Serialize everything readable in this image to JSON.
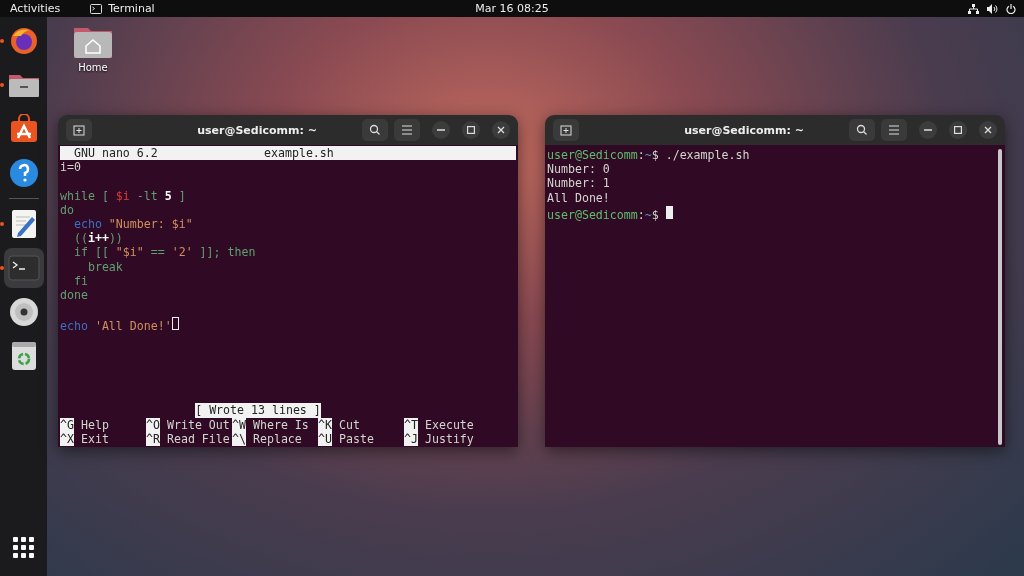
{
  "top_bar": {
    "activities": "Activities",
    "app_name": "Terminal",
    "clock": "Mar 16  08:25"
  },
  "dock": {
    "favorites": [
      {
        "kind": "browser",
        "running": true,
        "selected": false
      },
      {
        "kind": "files",
        "running": true,
        "selected": false
      },
      {
        "kind": "store",
        "running": false,
        "selected": false
      },
      {
        "kind": "help",
        "running": false,
        "selected": false
      }
    ],
    "others": [
      {
        "kind": "editor",
        "running": true,
        "selected": false
      },
      {
        "kind": "terminal",
        "running": true,
        "selected": true
      },
      {
        "kind": "disc",
        "running": false,
        "selected": false
      },
      {
        "kind": "trash",
        "running": false,
        "selected": false
      }
    ]
  },
  "desktop_icons": [
    {
      "label": "Home"
    }
  ],
  "windows": [
    {
      "kind": "nano",
      "title": "user@Sedicomm: ~",
      "header": {
        "app": "GNU nano 6.2",
        "file": "example.sh"
      },
      "lines": [
        {
          "kind": "code",
          "tokens": [
            {
              "text": "i=0",
              "kind": "plain"
            }
          ]
        },
        {
          "kind": "blank"
        },
        {
          "kind": "code",
          "tokens": [
            {
              "text": "while [ ",
              "kind": "keyword"
            },
            {
              "text": "$i",
              "kind": "variable"
            },
            {
              "text": " -lt ",
              "kind": "keyword"
            },
            {
              "text": "5",
              "kind": "number"
            },
            {
              "text": " ]",
              "kind": "keyword"
            }
          ]
        },
        {
          "kind": "code",
          "tokens": [
            {
              "text": "do",
              "kind": "keyword"
            }
          ]
        },
        {
          "kind": "code",
          "tokens": [
            {
              "text": "  echo",
              "kind": "builtin"
            },
            {
              "text": " \"Number: $i\"",
              "kind": "string"
            }
          ]
        },
        {
          "kind": "code",
          "tokens": [
            {
              "text": "  ((",
              "kind": "keyword"
            },
            {
              "text": "i++",
              "kind": "number"
            },
            {
              "text": "))",
              "kind": "keyword"
            }
          ]
        },
        {
          "kind": "code",
          "tokens": [
            {
              "text": "  if [[ ",
              "kind": "keyword"
            },
            {
              "text": "\"$i\"",
              "kind": "string"
            },
            {
              "text": " == ",
              "kind": "keyword"
            },
            {
              "text": "'2'",
              "kind": "string"
            },
            {
              "text": " ]]; then",
              "kind": "keyword"
            }
          ]
        },
        {
          "kind": "code",
          "tokens": [
            {
              "text": "    break",
              "kind": "keyword"
            }
          ]
        },
        {
          "kind": "code",
          "tokens": [
            {
              "text": "  fi",
              "kind": "keyword"
            }
          ]
        },
        {
          "kind": "code",
          "tokens": [
            {
              "text": "done",
              "kind": "keyword"
            }
          ]
        },
        {
          "kind": "blank"
        },
        {
          "kind": "code",
          "tokens": [
            {
              "text": "echo",
              "kind": "builtin"
            },
            {
              "text": " 'All Done!'",
              "kind": "string"
            },
            {
              "kind": "cursor"
            }
          ]
        }
      ],
      "status": "[ Wrote 13 lines ]",
      "shortcuts": [
        [
          {
            "key": "^G",
            "label": "Help"
          },
          {
            "key": "^O",
            "label": "Write Out"
          },
          {
            "key": "^W",
            "label": "Where Is"
          },
          {
            "key": "^K",
            "label": "Cut"
          },
          {
            "key": "^T",
            "label": "Execute"
          }
        ],
        [
          {
            "key": "^X",
            "label": "Exit"
          },
          {
            "key": "^R",
            "label": "Read File"
          },
          {
            "key": "^\\",
            "label": "Replace"
          },
          {
            "key": "^U",
            "label": "Paste"
          },
          {
            "key": "^J",
            "label": "Justify"
          }
        ]
      ]
    },
    {
      "kind": "shell",
      "title": "user@Sedicomm: ~",
      "lines": [
        {
          "kind": "code",
          "tokens": [
            {
              "text": "user@Sedicomm",
              "kind": "user"
            },
            {
              "text": ":",
              "kind": "plain"
            },
            {
              "text": "~",
              "kind": "path"
            },
            {
              "text": "$ ./example.sh",
              "kind": "plain"
            }
          ]
        },
        {
          "kind": "code",
          "tokens": [
            {
              "text": "Number: 0",
              "kind": "plain"
            }
          ]
        },
        {
          "kind": "code",
          "tokens": [
            {
              "text": "Number: 1",
              "kind": "plain"
            }
          ]
        },
        {
          "kind": "code",
          "tokens": [
            {
              "text": "All Done!",
              "kind": "plain"
            }
          ]
        },
        {
          "kind": "code",
          "tokens": [
            {
              "text": "user@Sedicomm",
              "kind": "user"
            },
            {
              "text": ":",
              "kind": "plain"
            },
            {
              "text": "~",
              "kind": "path"
            },
            {
              "text": "$ ",
              "kind": "plain"
            },
            {
              "kind": "cursor"
            }
          ]
        }
      ]
    }
  ]
}
